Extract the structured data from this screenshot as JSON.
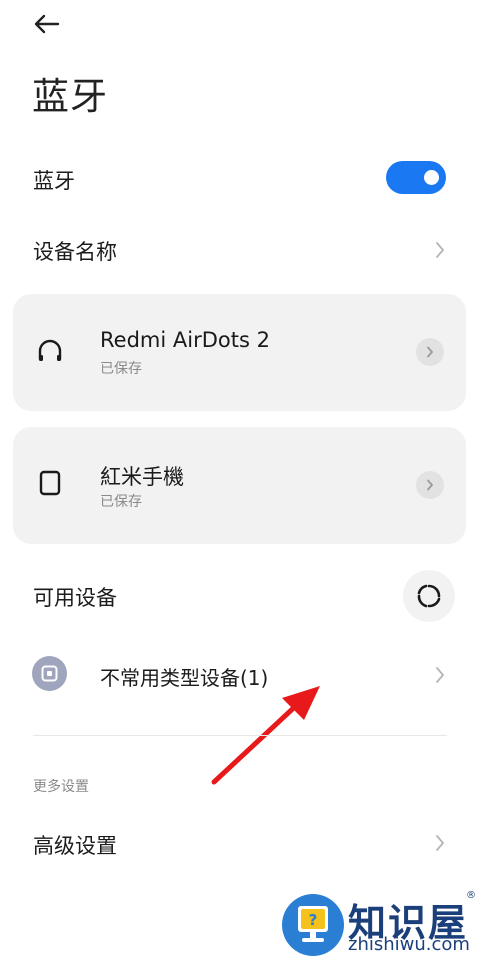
{
  "header": {
    "back_icon": "arrow-left-icon",
    "title": "蓝牙"
  },
  "bluetooth_row": {
    "label": "蓝牙",
    "toggle_on": true,
    "accent_color": "#1a78f2"
  },
  "device_name_row": {
    "label": "设备名称"
  },
  "saved_devices": [
    {
      "name": "Redmi AirDots 2",
      "status": "已保存",
      "icon": "headphones-icon"
    },
    {
      "name": "紅米手機",
      "status": "已保存",
      "icon": "phone-icon"
    }
  ],
  "available": {
    "label": "可用设备",
    "refresh_icon": "refresh-icon",
    "items": [
      {
        "label": "不常用类型设备(1)",
        "icon": "device-type-icon"
      }
    ]
  },
  "more_settings": {
    "section_label": "更多设置",
    "advanced_label": "高级设置"
  },
  "watermark": {
    "brand": "知识屋",
    "domain": "zhishiwu.com",
    "reg_mark": "®"
  }
}
